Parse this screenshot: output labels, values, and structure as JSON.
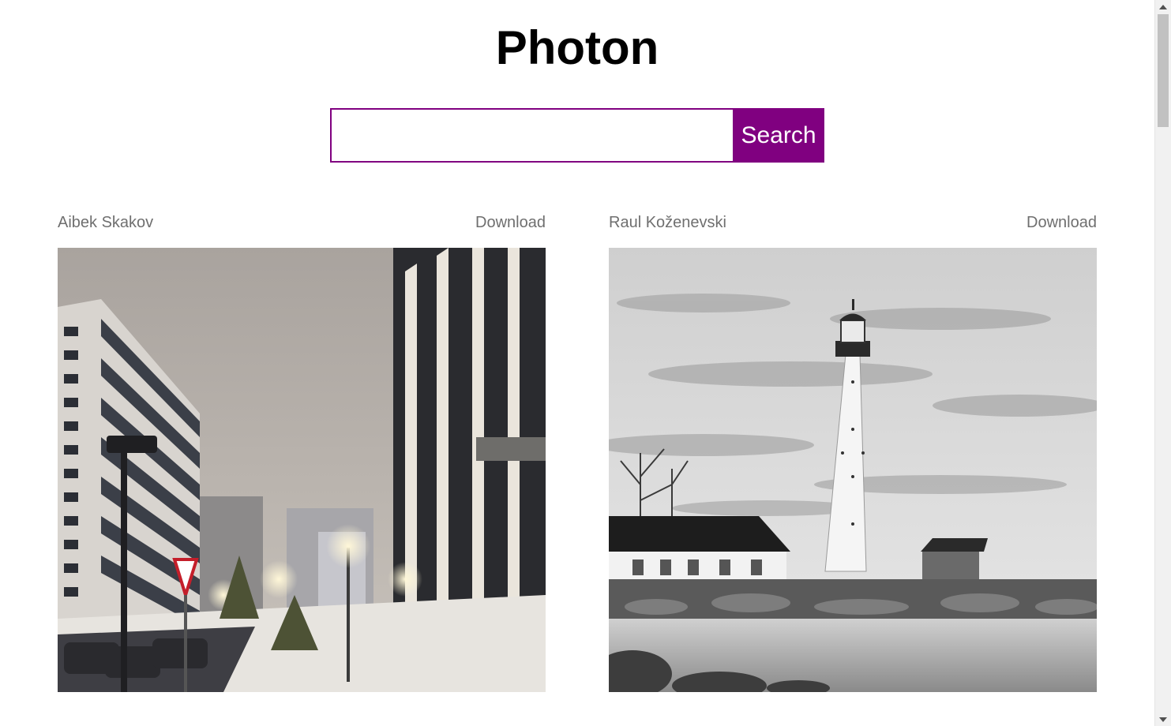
{
  "app": {
    "title": "Photon"
  },
  "search": {
    "placeholder": "",
    "value": "",
    "button_label": "Search"
  },
  "accent_color": "#800080",
  "photos": [
    {
      "author": "Aibek Skakov",
      "download_label": "Download",
      "subject": "snowy city street at night"
    },
    {
      "author": "Raul Koženevski",
      "download_label": "Download",
      "subject": "black and white lighthouse by the sea"
    }
  ],
  "icons": [
    "scroll-up-arrow-icon",
    "scroll-down-arrow-icon"
  ]
}
